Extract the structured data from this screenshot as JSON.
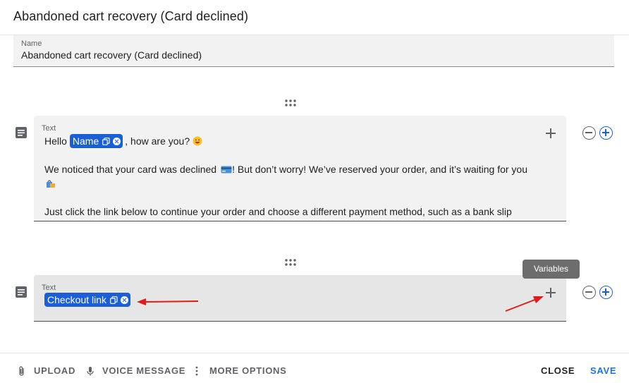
{
  "dialog": {
    "title": "Abandoned cart recovery (Card declined)"
  },
  "name_field": {
    "label": "Name",
    "value": "Abandoned cart recovery (Card declined)"
  },
  "blocks": [
    {
      "label": "Text",
      "line1_prefix": "Hello",
      "chip": "Name",
      "line1_suffix": ", how are you?",
      "line1_emoji": "grinning-face-icon",
      "line2": "We noticed that your card was declined",
      "line2_emoji": "credit-card-icon",
      "line2_rest": "! But don’t worry! We’ve reserved your order, and it’s waiting for you",
      "line3_emoji": "shopping-bags-icon",
      "line4": "Just click the link below to continue your order and choose a different payment method, such as a bank slip"
    },
    {
      "label": "Text",
      "chip": "Checkout link"
    }
  ],
  "tooltip": "Variables",
  "footer": {
    "upload": "UPLOAD",
    "voice": "VOICE MESSAGE",
    "more": "MORE OPTIONS",
    "close": "CLOSE",
    "save": "SAVE"
  },
  "colors": {
    "chip": "#1a5fd6",
    "accent": "#1a73e8",
    "annotation_arrow": "#e01b1b"
  }
}
